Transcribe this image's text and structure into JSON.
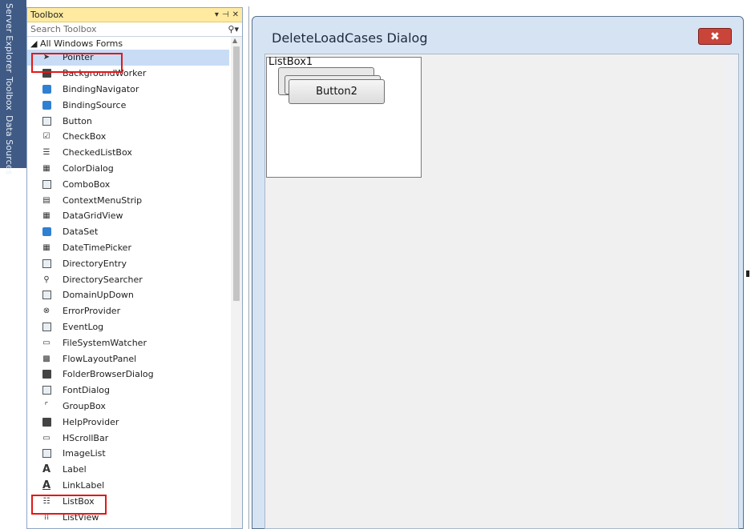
{
  "side_tabs": [
    "Server Explorer",
    "Toolbox",
    "Data Sources"
  ],
  "toolbox": {
    "title": "Toolbox",
    "controls": [
      "▾",
      "⊣",
      "✕"
    ],
    "search_placeholder": "Search Toolbox",
    "search_icon": "search-icon",
    "category": "◢ All Windows Forms",
    "items": [
      {
        "label": "Pointer",
        "icon": "pointer-icon"
      },
      {
        "label": "BackgroundWorker",
        "icon": "backgroundworker-icon"
      },
      {
        "label": "BindingNavigator",
        "icon": "bindingnavigator-icon"
      },
      {
        "label": "BindingSource",
        "icon": "bindingsource-icon"
      },
      {
        "label": "Button",
        "icon": "button-icon"
      },
      {
        "label": "CheckBox",
        "icon": "checkbox-icon"
      },
      {
        "label": "CheckedListBox",
        "icon": "checkedlistbox-icon"
      },
      {
        "label": "ColorDialog",
        "icon": "colordialog-icon"
      },
      {
        "label": "ComboBox",
        "icon": "combobox-icon"
      },
      {
        "label": "ContextMenuStrip",
        "icon": "contextmenustrip-icon"
      },
      {
        "label": "DataGridView",
        "icon": "datagridview-icon"
      },
      {
        "label": "DataSet",
        "icon": "dataset-icon"
      },
      {
        "label": "DateTimePicker",
        "icon": "datetimepicker-icon"
      },
      {
        "label": "DirectoryEntry",
        "icon": "directoryentry-icon"
      },
      {
        "label": "DirectorySearcher",
        "icon": "directorysearcher-icon"
      },
      {
        "label": "DomainUpDown",
        "icon": "domainupdown-icon"
      },
      {
        "label": "ErrorProvider",
        "icon": "errorprovider-icon"
      },
      {
        "label": "EventLog",
        "icon": "eventlog-icon"
      },
      {
        "label": "FileSystemWatcher",
        "icon": "filesystemwatcher-icon"
      },
      {
        "label": "FlowLayoutPanel",
        "icon": "flowlayoutpanel-icon"
      },
      {
        "label": "FolderBrowserDialog",
        "icon": "folderbrowserdialog-icon"
      },
      {
        "label": "FontDialog",
        "icon": "fontdialog-icon"
      },
      {
        "label": "GroupBox",
        "icon": "groupbox-icon"
      },
      {
        "label": "HelpProvider",
        "icon": "helpprovider-icon"
      },
      {
        "label": "HScrollBar",
        "icon": "hscrollbar-icon"
      },
      {
        "label": "ImageList",
        "icon": "imagelist-icon"
      },
      {
        "label": "Label",
        "icon": "label-icon"
      },
      {
        "label": "LinkLabel",
        "icon": "linklabel-icon"
      },
      {
        "label": "ListBox",
        "icon": "listbox-icon"
      },
      {
        "label": "ListView",
        "icon": "listview-icon"
      }
    ],
    "selected_index": 0
  },
  "designer": {
    "dialog_title": "DeleteLoadCases Dialog",
    "close_glyph": "✖",
    "listbox_label": "ListBox1",
    "button2_label": "Button2"
  },
  "colors": {
    "highlight": "#e21818",
    "close_button": "#c9453a",
    "toolbox_title_bg": "#ffeaa0",
    "side_strip": "#3f5b85"
  }
}
